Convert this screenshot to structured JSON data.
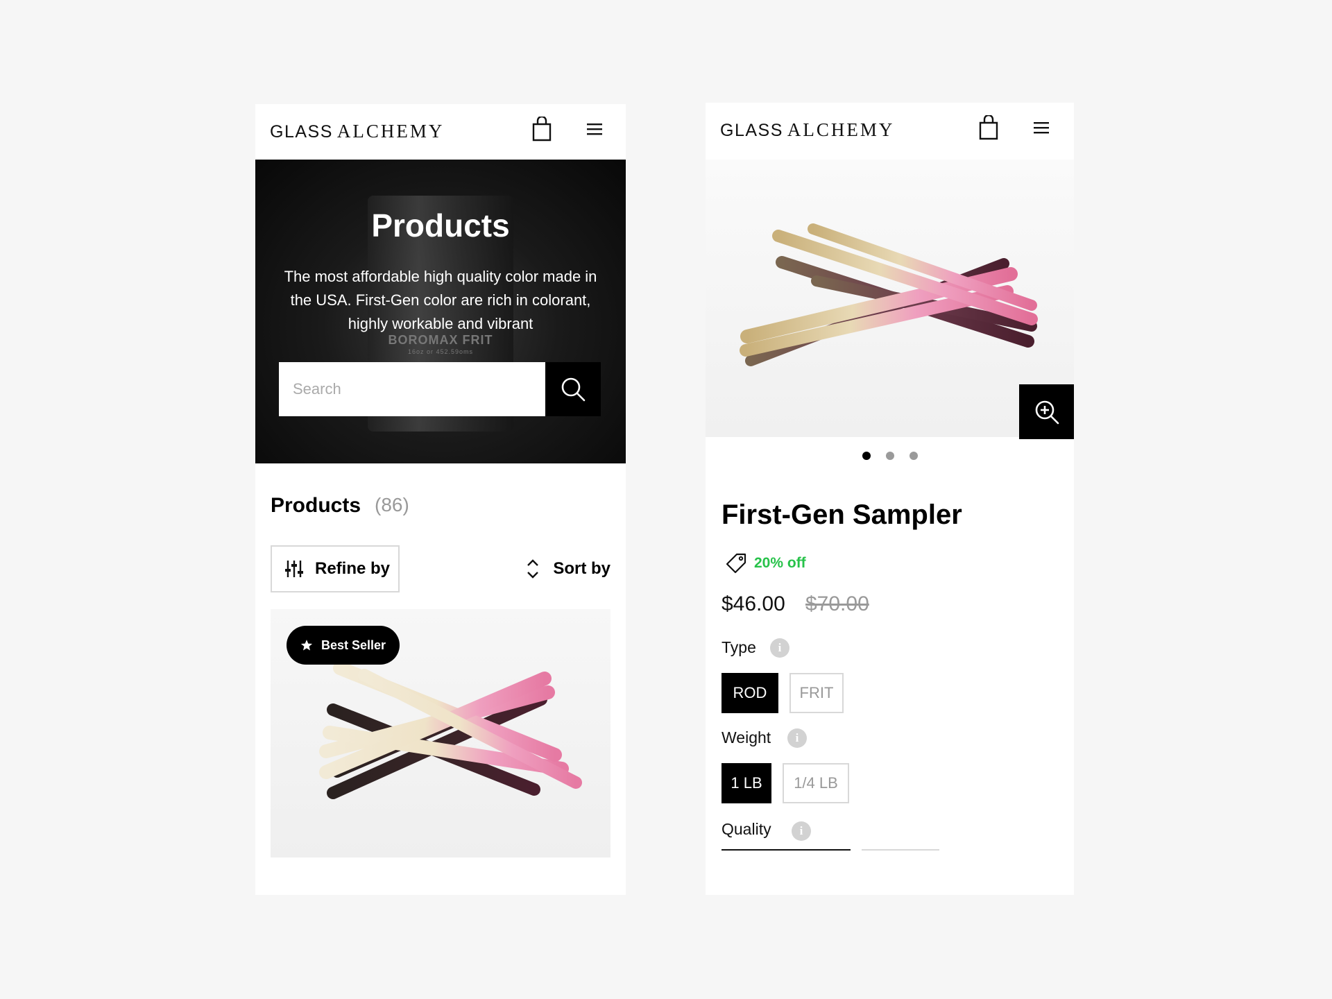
{
  "left_screen": {
    "header": {
      "logo_part1": "GLASS",
      "logo_part2": "ALCHEMY",
      "cart_icon": "shopping-bag-icon",
      "menu_icon": "hamburger-menu-icon"
    },
    "hero": {
      "title": "Products",
      "description": "The most affordable high quality color made in the USA. First-Gen color are rich in colorant, highly workable and vibrant",
      "jar_label": "BOROMAX FRIT",
      "jar_sublabel": "16oz or 452.59oms",
      "search": {
        "placeholder": "Search",
        "value": "",
        "button_icon": "search-icon"
      }
    },
    "listing": {
      "heading": "Products",
      "count": "(86)",
      "refine_label": "Refine by",
      "refine_icon": "sliders-icon",
      "sort_label": "Sort by",
      "sort_icon": "sort-arrows-icon",
      "card": {
        "badge_label": "Best Seller",
        "badge_icon": "star-icon"
      }
    }
  },
  "right_screen": {
    "header": {
      "logo_part1": "GLASS",
      "logo_part2": "ALCHEMY",
      "cart_icon": "shopping-bag-icon",
      "menu_icon": "hamburger-menu-icon"
    },
    "gallery": {
      "zoom_icon": "zoom-in-icon",
      "slides": 3,
      "active_slide": 1
    },
    "product": {
      "title": "First-Gen Sampler",
      "discount_icon": "price-tag-icon",
      "discount": "20% off",
      "price": "$46.00",
      "original_price": "$70.00",
      "type": {
        "label": "Type",
        "options": [
          "ROD",
          "FRIT"
        ],
        "selected": "ROD"
      },
      "weight": {
        "label": "Weight",
        "options": [
          "1 LB",
          "1/4 LB"
        ],
        "selected": "1 LB"
      },
      "quality": {
        "label": "Quality"
      },
      "info_icon": "info-icon",
      "info_glyph": "i"
    }
  },
  "colors": {
    "background": "#f6f6f6",
    "black": "#000000",
    "discount_green": "#27c24a",
    "muted_gray": "#999999",
    "rod_pink": "#e98bb0",
    "rod_cream": "#efe3c8",
    "rod_plum": "#4a1f2e"
  }
}
